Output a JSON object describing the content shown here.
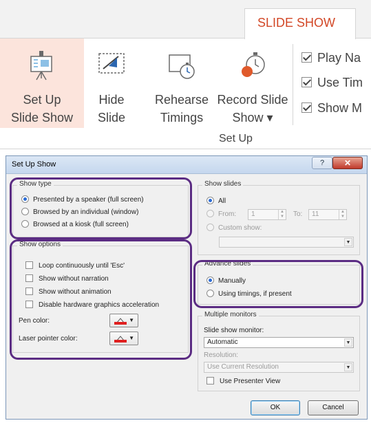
{
  "ribbon": {
    "tab_label": "SLIDE SHOW",
    "buttons": [
      {
        "line1": "Set Up",
        "line2": "Slide Show"
      },
      {
        "line1": "Hide",
        "line2": "Slide"
      },
      {
        "line1": "Rehearse",
        "line2": "Timings"
      },
      {
        "line1": "Record Slide",
        "line2": "Show ▾"
      }
    ],
    "checkboxes": [
      "Play Na",
      "Use Tim",
      "Show M"
    ],
    "group_label": "Set Up"
  },
  "dialog": {
    "title": "Set Up Show",
    "help_label": "?",
    "close_label": "✕",
    "show_type": {
      "title": "Show type",
      "options": [
        {
          "text": "Presented by a speaker (full screen)",
          "selected": true
        },
        {
          "text": "Browsed by an individual (window)",
          "selected": false
        },
        {
          "text": "Browsed at a kiosk (full screen)",
          "selected": false
        }
      ]
    },
    "show_options": {
      "title": "Show options",
      "options": [
        "Loop continuously until 'Esc'",
        "Show without narration",
        "Show without animation",
        "Disable hardware graphics acceleration"
      ],
      "pen_color_label": "Pen color:",
      "laser_color_label": "Laser pointer color:",
      "pen_color": "#e02020",
      "laser_color": "#e02020"
    },
    "show_slides": {
      "title": "Show slides",
      "all_label": "All",
      "from_label": "From:",
      "from_value": "1",
      "to_label": "To:",
      "to_value": "11",
      "custom_label": "Custom show:"
    },
    "advance": {
      "title": "Advance slides",
      "manual_label": "Manually",
      "timings_label": "Using timings, if present"
    },
    "monitors": {
      "title": "Multiple monitors",
      "monitor_label": "Slide show monitor:",
      "monitor_value": "Automatic",
      "resolution_label": "Resolution:",
      "resolution_value": "Use Current Resolution",
      "presenter_label": "Use Presenter View"
    },
    "ok_label": "OK",
    "cancel_label": "Cancel"
  },
  "colors": {
    "accent": "#d24726",
    "highlight": "#5b2c83"
  }
}
